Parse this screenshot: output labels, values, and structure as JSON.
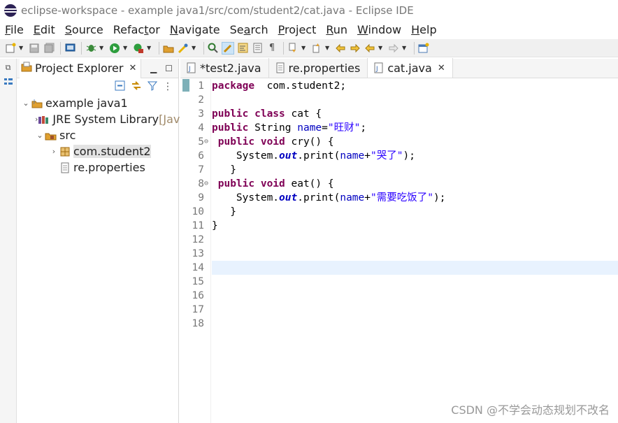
{
  "window": {
    "title": "eclipse-workspace - example java1/src/com/student2/cat.java - Eclipse IDE"
  },
  "menu": [
    {
      "u": "F",
      "rest": "ile"
    },
    {
      "u": "E",
      "rest": "dit"
    },
    {
      "u": "S",
      "rest": "ource"
    },
    {
      "pre": "Refac",
      "u": "t",
      "rest": "or"
    },
    {
      "u": "N",
      "rest": "avigate"
    },
    {
      "pre": "Se",
      "u": "a",
      "rest": "rch"
    },
    {
      "u": "P",
      "rest": "roject"
    },
    {
      "u": "R",
      "rest": "un"
    },
    {
      "u": "W",
      "rest": "indow"
    },
    {
      "u": "H",
      "rest": "elp"
    }
  ],
  "explorer": {
    "tab_label": "Project Explorer",
    "tree": [
      {
        "label": "example java1",
        "extra": "",
        "depth": 0,
        "arrow": "⌄",
        "icon": "project-icon"
      },
      {
        "label": "JRE System Library",
        "extra": " [Java",
        "depth": 1,
        "arrow": "›",
        "icon": "library-icon"
      },
      {
        "label": "src",
        "extra": "",
        "depth": 1,
        "arrow": "⌄",
        "icon": "source-folder-icon"
      },
      {
        "label": "com.student2",
        "extra": "",
        "depth": 2,
        "arrow": "›",
        "icon": "package-icon",
        "selected": true
      },
      {
        "label": "re.properties",
        "extra": "",
        "depth": 2,
        "arrow": "",
        "icon": "file-icon"
      }
    ]
  },
  "editor": {
    "tabs": [
      {
        "label": "*test2.java",
        "icon": "java-file-icon",
        "active": false,
        "closable": false
      },
      {
        "label": "re.properties",
        "icon": "properties-file-icon",
        "active": false,
        "closable": false
      },
      {
        "label": "cat.java",
        "icon": "java-file-icon",
        "active": true,
        "closable": true
      }
    ],
    "current_line": 14,
    "lines": [
      {
        "n": "1",
        "fold": "",
        "tokens": [
          [
            "kw",
            "package"
          ],
          [
            "",
            "  com.student2;"
          ]
        ]
      },
      {
        "n": "2",
        "fold": "",
        "tokens": []
      },
      {
        "n": "3",
        "fold": "",
        "tokens": [
          [
            "kw",
            "public class"
          ],
          [
            "",
            " cat {"
          ]
        ]
      },
      {
        "n": "4",
        "fold": "",
        "tokens": [
          [
            "kw",
            "public"
          ],
          [
            "",
            " String "
          ],
          [
            "fld",
            "name"
          ],
          [
            "",
            "="
          ],
          [
            "str",
            "\"旺财\""
          ],
          [
            "",
            ";"
          ]
        ]
      },
      {
        "n": "5",
        "fold": "⊖",
        "tokens": [
          [
            "",
            " "
          ],
          [
            "kw",
            "public void"
          ],
          [
            "",
            " cry() {"
          ]
        ]
      },
      {
        "n": "6",
        "fold": "",
        "tokens": [
          [
            "",
            "    System."
          ],
          [
            "sfld",
            "out"
          ],
          [
            "",
            ".print("
          ],
          [
            "fld",
            "name"
          ],
          [
            "",
            "+"
          ],
          [
            "str",
            "\"哭了\""
          ],
          [
            "",
            ");"
          ]
        ]
      },
      {
        "n": "7",
        "fold": "",
        "tokens": [
          [
            "",
            "   }"
          ]
        ]
      },
      {
        "n": "8",
        "fold": "⊖",
        "tokens": [
          [
            "",
            " "
          ],
          [
            "kw",
            "public void"
          ],
          [
            "",
            " eat() {"
          ]
        ]
      },
      {
        "n": "9",
        "fold": "",
        "tokens": [
          [
            "",
            "    System."
          ],
          [
            "sfld",
            "out"
          ],
          [
            "",
            ".print("
          ],
          [
            "fld",
            "name"
          ],
          [
            "",
            "+"
          ],
          [
            "str",
            "\"需要吃饭了\""
          ],
          [
            "",
            ");"
          ]
        ]
      },
      {
        "n": "10",
        "fold": "",
        "tokens": [
          [
            "",
            "   }"
          ]
        ]
      },
      {
        "n": "11",
        "fold": "",
        "tokens": [
          [
            "",
            "}"
          ]
        ]
      },
      {
        "n": "12",
        "fold": "",
        "tokens": []
      },
      {
        "n": "13",
        "fold": "",
        "tokens": []
      },
      {
        "n": "14",
        "fold": "",
        "tokens": []
      },
      {
        "n": "15",
        "fold": "",
        "tokens": []
      },
      {
        "n": "16",
        "fold": "",
        "tokens": []
      },
      {
        "n": "17",
        "fold": "",
        "tokens": []
      },
      {
        "n": "18",
        "fold": "",
        "tokens": []
      }
    ]
  },
  "watermark": "CSDN @不学会动态规划不改名",
  "colors": {
    "keyword": "#7f0055",
    "string": "#2a00ff",
    "field": "#0000c0",
    "current_line": "#e8f2fe"
  }
}
